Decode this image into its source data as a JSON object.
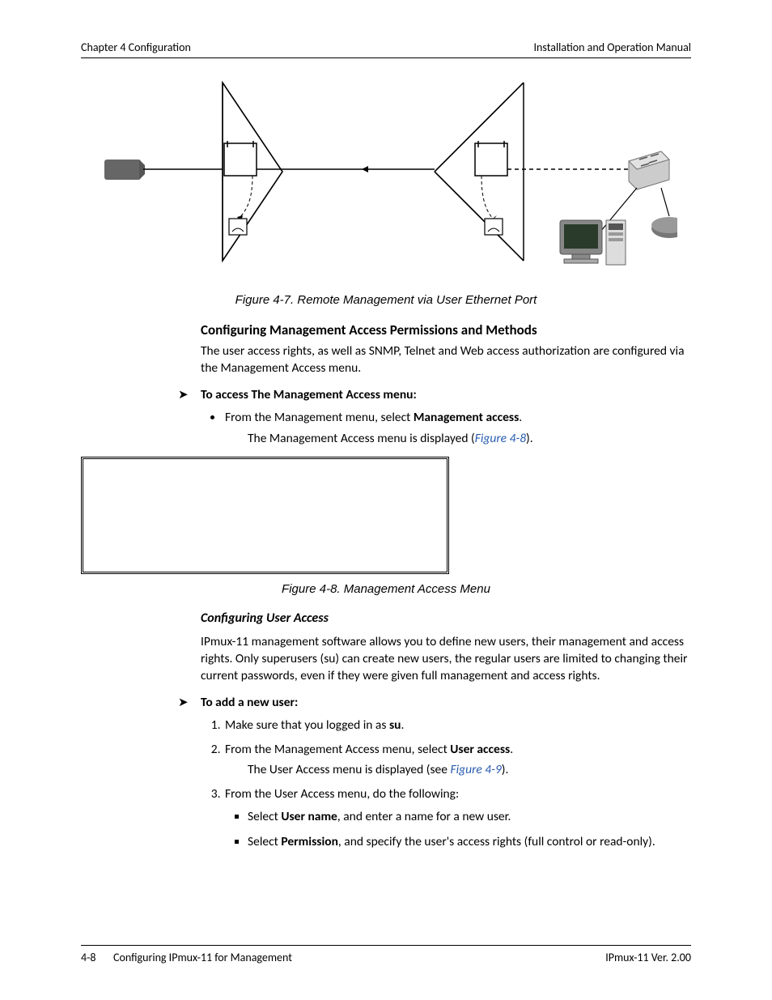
{
  "header": {
    "left": "Chapter 4  Configuration",
    "right": "Installation and Operation Manual"
  },
  "figure7": {
    "caption": "Figure 4-7.  Remote Management via User Ethernet Port"
  },
  "section1": {
    "heading": "Configuring Management Access Permissions and Methods",
    "para": "The user access rights, as well as SNMP, Telnet and Web access authorization are configured via the Management Access menu."
  },
  "proc1": {
    "heading": "To access The Management Access menu:",
    "step1_a": "From the Management menu, select ",
    "step1_b": "Management access",
    "step1_c": ".",
    "result_a": "The Management Access menu is displayed (",
    "result_link": "Figure 4-8",
    "result_c": ")."
  },
  "figure8": {
    "caption": "Figure 4-8.  Management Access Menu"
  },
  "section2": {
    "heading": "Configuring User Access",
    "para": "IPmux-11 management software allows you to define new users, their management and access rights. Only superusers (su) can create new users, the regular users are limited to changing their current passwords, even if they were given full management and access rights."
  },
  "proc2": {
    "heading": "To add a new user:",
    "s1_a": "Make sure that you logged in as ",
    "s1_b": "su",
    "s1_c": ".",
    "s2_a": "From the Management Access menu, select ",
    "s2_b": "User access",
    "s2_c": ".",
    "s2_res_a": "The User Access menu is displayed (see ",
    "s2_res_link": "Figure 4-9",
    "s2_res_c": ").",
    "s3": "From the User Access menu, do the following:",
    "s3_sub1_a": "Select ",
    "s3_sub1_b": "User name",
    "s3_sub1_c": ", and enter a name for a new user.",
    "s3_sub2_a": "Select ",
    "s3_sub2_b": "Permission",
    "s3_sub2_c": ", and specify the user's access rights (full control or read-only)."
  },
  "footer": {
    "pagenum": "4-8",
    "center": "Configuring IPmux-11 for Management",
    "right": "IPmux-11 Ver. 2.00"
  }
}
